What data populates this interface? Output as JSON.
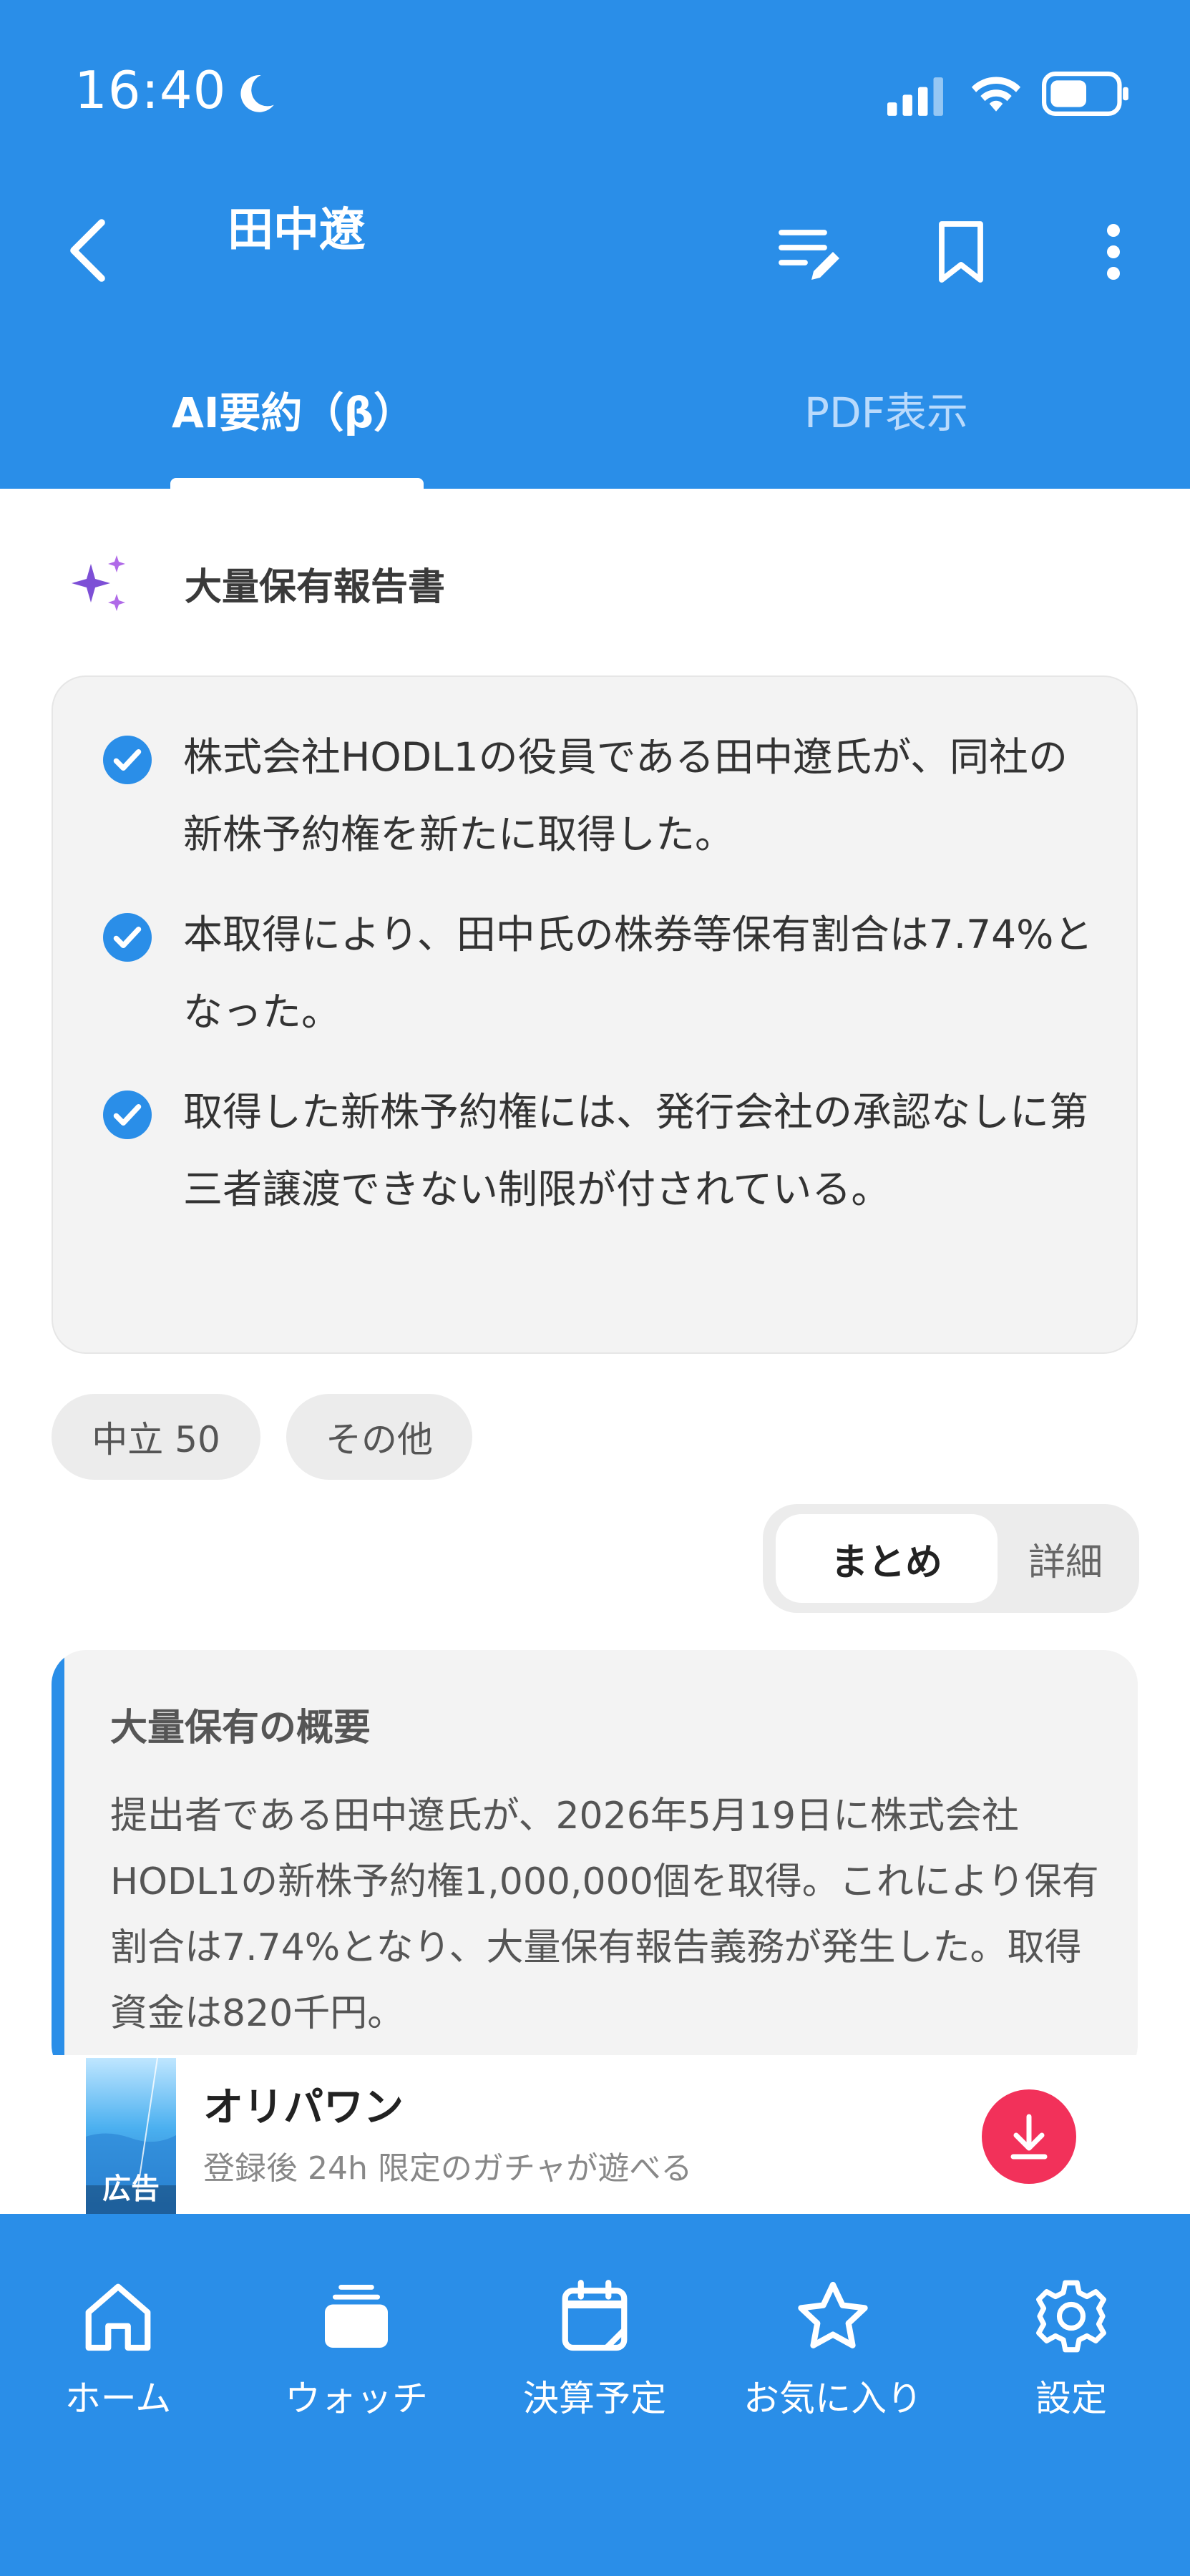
{
  "status_bar": {
    "time": "16:40"
  },
  "header": {
    "title": "田中遼",
    "tabs": [
      {
        "label": "AI要約（β）",
        "active": true
      },
      {
        "label": "PDF表示",
        "active": false
      }
    ]
  },
  "section": {
    "title": "大量保有報告書"
  },
  "summary": {
    "bullets": [
      "株式会社HODL1の役員である田中遼氏が、同社の新株予約権を新たに取得した。",
      "本取得により、田中氏の株券等保有割合は7.74%となった。",
      "取得した新株予約権には、発行会社の承認なしに第三者譲渡できない制限が付されている。"
    ]
  },
  "chips": {
    "neutral": "中立 50",
    "other": "その他"
  },
  "segmented": {
    "summary": "まとめ",
    "detail": "詳細"
  },
  "overview": {
    "title": "大量保有の概要",
    "body": "提出者である田中遼氏が、2026年5月19日に株式会社HODL1の新株予約権1,000,000個を取得。これにより保有割合は7.74%となり、大量保有報告義務が発生した。取得資金は820千円。"
  },
  "ad": {
    "label": "広告",
    "title": "オリパワン",
    "subtitle": "登録後 24h 限定のガチャが遊べる"
  },
  "tabbar": {
    "items": [
      {
        "label": "ホーム",
        "icon": "home-icon"
      },
      {
        "label": "ウォッチ",
        "icon": "watch-icon"
      },
      {
        "label": "決算予定",
        "icon": "calendar-icon"
      },
      {
        "label": "お気に入り",
        "icon": "star-icon"
      },
      {
        "label": "設定",
        "icon": "gear-icon"
      }
    ]
  },
  "colors": {
    "primary": "#2a8ee8",
    "sparkle": "#7d4fd6",
    "download": "#f2315a"
  }
}
